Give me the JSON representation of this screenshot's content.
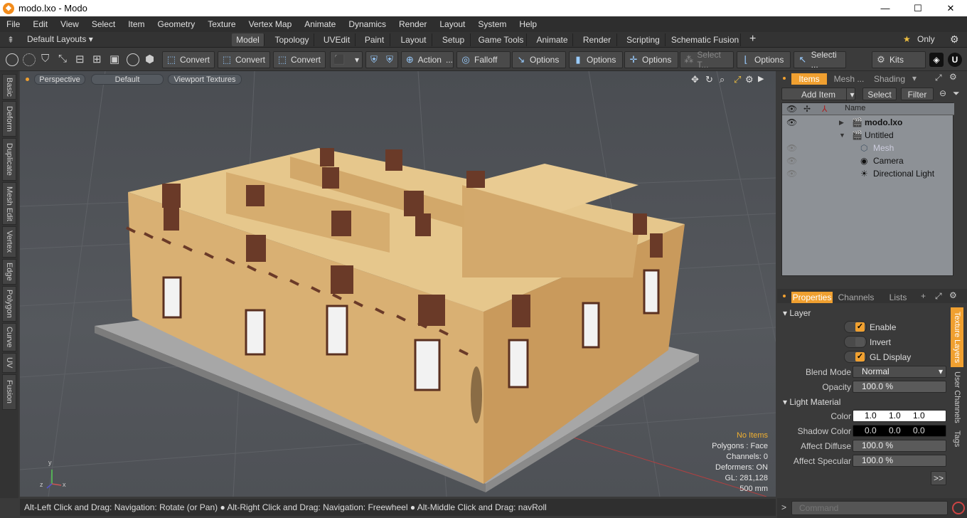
{
  "window": {
    "title": "modo.lxo - Modo",
    "min": "—",
    "max": "☐",
    "close": "✕"
  },
  "menu": [
    "File",
    "Edit",
    "View",
    "Select",
    "Item",
    "Geometry",
    "Texture",
    "Vertex Map",
    "Animate",
    "Dynamics",
    "Render",
    "Layout",
    "System",
    "Help"
  ],
  "layout_select": "Default Layouts ▾",
  "tabs": [
    "Model",
    "Topology",
    "UVEdit",
    "Paint",
    "Layout",
    "Setup",
    "Game Tools",
    "Animate",
    "Render",
    "Scripting",
    "Schematic Fusion"
  ],
  "tabs_active": "Model",
  "only_label": "Only",
  "toolbar": {
    "convert1": "Convert",
    "convert2": "Convert",
    "convert3": "Convert",
    "action": "Action",
    "falloff": "Falloff",
    "options1": "Options",
    "options2": "Options",
    "options3": "Options",
    "select_t": "Select T...",
    "options4": "Options",
    "selecti": "Selecti ...",
    "kits": "Kits"
  },
  "left_tabs": [
    "Basic",
    "Deform",
    "Duplicate",
    "Mesh Edit",
    "Vertex",
    "Edge",
    "Polygon",
    "Curve",
    "UV",
    "Fusion"
  ],
  "viewport": {
    "perspective": "Perspective",
    "default": "Default",
    "textures": "Viewport Textures",
    "info": {
      "no_items": "No Items",
      "polygons": "Polygons : Face",
      "channels": "Channels: 0",
      "deformers": "Deformers: ON",
      "gl": "GL: 281,128",
      "scale": "500 mm"
    }
  },
  "statusbar": "Alt-Left Click and Drag: Navigation: Rotate (or Pan) ● Alt-Right Click and Drag: Navigation: Freewheel ● Alt-Middle Click and Drag: navRoll",
  "items_panel": {
    "tabs": [
      "Items",
      "Mesh ...",
      "Shading"
    ],
    "add_item": "Add Item",
    "select": "Select",
    "filter": "Filter",
    "name_header": "Name",
    "tree": [
      {
        "label": "modo.lxo"
      },
      {
        "label": "Untitled"
      },
      {
        "label": "Mesh"
      },
      {
        "label": "Camera"
      },
      {
        "label": "Directional Light"
      }
    ]
  },
  "properties": {
    "tabs": [
      "Properties",
      "Channels",
      "Lists"
    ],
    "layer_header": "Layer",
    "enable": "Enable",
    "invert": "Invert",
    "gl_display": "GL Display",
    "blend_mode_label": "Blend Mode",
    "blend_mode": "Normal",
    "opacity_label": "Opacity",
    "opacity": "100.0 %",
    "light_material": "Light Material",
    "color_label": "Color",
    "color": [
      "1.0",
      "1.0",
      "1.0"
    ],
    "shadow_label": "Shadow Color",
    "shadow": [
      "0.0",
      "0.0",
      "0.0"
    ],
    "diffuse_label": "Affect Diffuse",
    "diffuse": "100.0 %",
    "specular_label": "Affect Specular",
    "specular": "100.0 %",
    "more": ">>",
    "side_tabs": [
      "Texture Layers",
      "User Channels",
      "Tags"
    ]
  },
  "command_placeholder": "Command",
  "colors": {
    "accent": "#f0a030",
    "wall": "#dcb273",
    "ground": "#9a9a9a"
  }
}
